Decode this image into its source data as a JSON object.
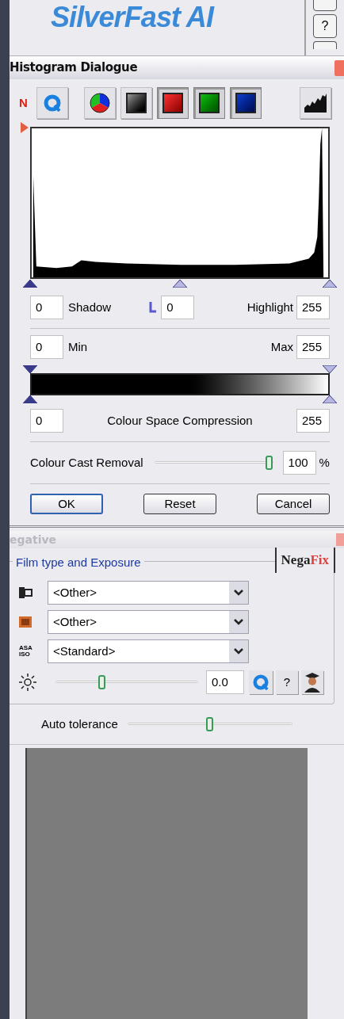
{
  "app": {
    "logo": "SilverFast AI",
    "side_buttons": [
      {
        "label": "?"
      }
    ]
  },
  "histogram_dialog": {
    "title": "Histogram Dialogue",
    "mode_label": "N",
    "channels": [
      {
        "kind": "rgb",
        "selected": false
      },
      {
        "kind": "grey",
        "selected": false
      },
      {
        "kind": "red",
        "selected": true
      },
      {
        "kind": "green",
        "selected": true
      },
      {
        "kind": "blue",
        "selected": true
      }
    ],
    "shadow": {
      "value": "0",
      "label": "Shadow"
    },
    "midtone": {
      "value": "0"
    },
    "highlight": {
      "label": "Highlight",
      "value": "255"
    },
    "min": {
      "value": "0",
      "label": "Min"
    },
    "max": {
      "label": "Max",
      "value": "255"
    },
    "compression": {
      "min": "0",
      "label": "Colour Space Compression",
      "max": "255"
    },
    "cast_removal": {
      "label": "Colour Cast Removal",
      "level": 0.97,
      "value": "100",
      "unit": "%"
    },
    "buttons": [
      {
        "label": "OK",
        "default": true
      },
      {
        "label": "Reset",
        "default": false
      },
      {
        "label": "Cancel",
        "default": false
      }
    ]
  },
  "negative_dialog": {
    "title": "egative",
    "group_title": "Film type and Exposure",
    "logo": {
      "part1": "Nega",
      "part2": "Fix"
    },
    "selects": [
      {
        "kind": "manufacturer",
        "value": "<Other>"
      },
      {
        "kind": "film",
        "value": "<Other>"
      },
      {
        "kind": "iso",
        "value": "<Standard>",
        "icon_text": [
          "ASA",
          "ISO"
        ]
      }
    ],
    "exposure": {
      "level": 0.33,
      "value": "0.0",
      "help": "?"
    },
    "auto_tolerance": {
      "label": "Auto tolerance",
      "level": 0.5
    }
  }
}
